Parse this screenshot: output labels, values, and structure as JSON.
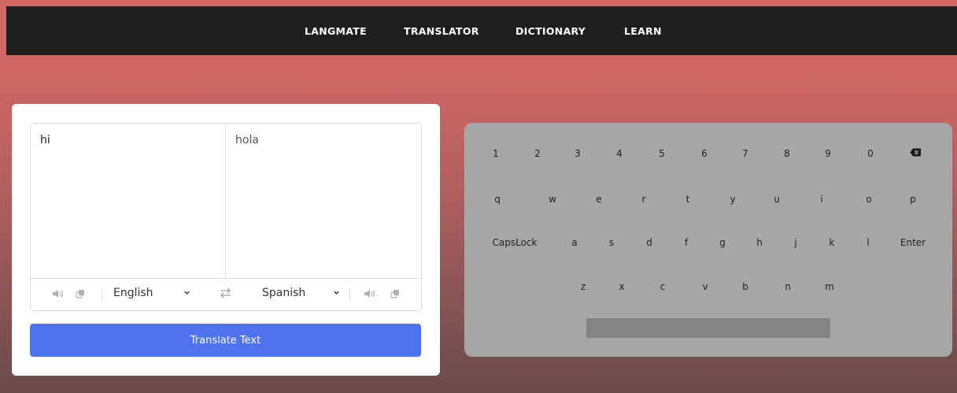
{
  "nav": {
    "items": [
      {
        "label": "LANGMATE"
      },
      {
        "label": "TRANSLATOR"
      },
      {
        "label": "DICTIONARY"
      },
      {
        "label": "LEARN"
      }
    ]
  },
  "translator": {
    "source_text": "hi",
    "target_text": "hola",
    "source_language": "English",
    "target_language": "Spanish",
    "icons": {
      "speak": "speaker-icon",
      "copy": "copy-icon",
      "swap": "swap-icon",
      "dropdown": "chevron-down-icon"
    },
    "button_label": "Translate Text"
  },
  "keyboard": {
    "row1": [
      "1",
      "2",
      "3",
      "4",
      "5",
      "6",
      "7",
      "8",
      "9",
      "0"
    ],
    "row2": [
      "q",
      "w",
      "e",
      "r",
      "t",
      "y",
      "u",
      "i",
      "o",
      "p"
    ],
    "row3": [
      "CapsLock",
      "a",
      "s",
      "d",
      "f",
      "g",
      "h",
      "j",
      "k",
      "l",
      "Enter"
    ],
    "row4": [
      "z",
      "x",
      "c",
      "v",
      "b",
      "n",
      "m"
    ],
    "backspace_icon": "backspace-icon"
  },
  "colors": {
    "nav_bg": "#1e1e1e",
    "accent": "#4f73ee",
    "keyboard_bg": "#a7a7a7",
    "spacebar": "#848484"
  }
}
